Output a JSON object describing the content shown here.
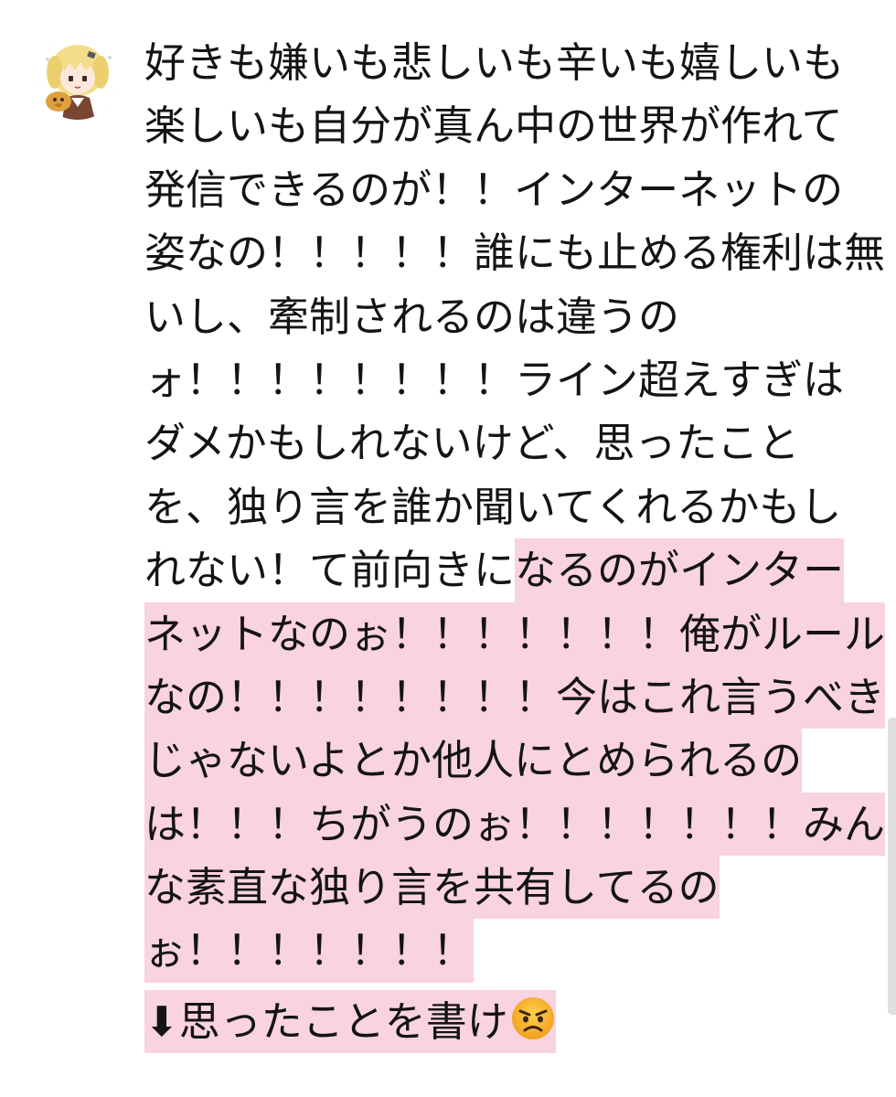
{
  "post": {
    "lines": [
      {
        "plain": "好きも嫌いも悲しいも辛いも嬉しいも",
        "highlight": ""
      },
      {
        "plain": "楽しいも自分が真ん中の世界が作れて",
        "highlight": ""
      },
      {
        "plain": "発信できるのが！！インターネットの",
        "highlight": ""
      },
      {
        "plain": "姿なの！！！！！誰にも止める権利は無",
        "highlight": ""
      },
      {
        "plain": "いし、牽制されるのは違うの",
        "highlight": ""
      },
      {
        "plain": "ォ！！！！！！！！ライン超えすぎは",
        "highlight": ""
      },
      {
        "plain": "ダメかもしれないけど、思ったこと",
        "highlight": ""
      },
      {
        "plain": "を、独り言を誰か聞いてくれるかもし",
        "highlight": ""
      },
      {
        "plain": "れない！て前向きに",
        "highlight": "なるのがインター"
      },
      {
        "plain": "",
        "highlight": "ネットなのぉ！！！！！！！俺がルール"
      },
      {
        "plain": "",
        "highlight": "なの！！！！！！！！今はこれ言うべき"
      },
      {
        "plain": "",
        "highlight": "じゃないよとか他人にとめられるの"
      },
      {
        "plain": "",
        "highlight": "は！！！ちがうのぉ！！！！！！！みん"
      },
      {
        "plain": "",
        "highlight": "な素直な独り言を共有してるの"
      },
      {
        "plain": "",
        "highlight": "ぉ！！！！！！！"
      }
    ],
    "last_line_text": "⬇思ったことを書け",
    "highlight_color": "#f9d3df"
  },
  "avatar": {
    "icon": "anime-girl-avatar"
  },
  "emoji": {
    "icon": "angry-face-emoji"
  }
}
